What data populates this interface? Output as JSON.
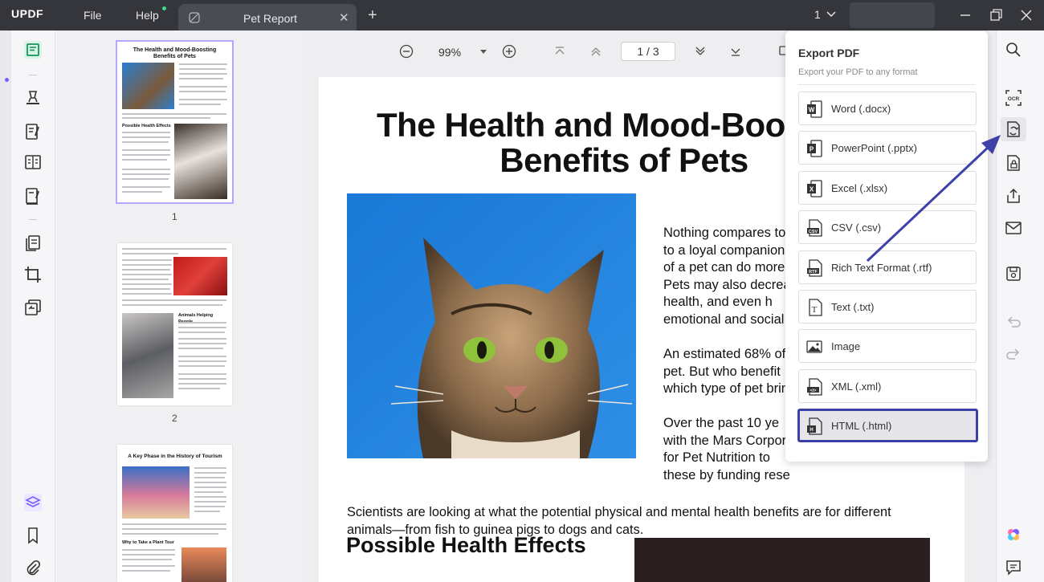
{
  "titlebar": {
    "logo": "UPDF",
    "menu": [
      "File",
      "Help"
    ],
    "tab_title": "Pet Report",
    "page_selector": "1"
  },
  "toolbar": {
    "zoom": "99%",
    "page_indicator": "1 / 3"
  },
  "thumbnails": {
    "pages": [
      {
        "number": "1",
        "title": "The Health and Mood-Boosting Benefits of Pets",
        "heading": "Possible Health Effects"
      },
      {
        "number": "2",
        "heading": "Animals Helping People"
      },
      {
        "title": "A Key Phase in the History of Tourism",
        "heading": "Why to Take a Plant Tour"
      }
    ]
  },
  "document": {
    "title_line1": "The Health and Mood-Boo",
    "title_line2": "Benefits of Pets",
    "para1": [
      "Nothing compares to",
      "to a loyal companion",
      "of a pet can do more",
      "Pets may also decrea",
      "health, and even h",
      "emotional and social"
    ],
    "para2": [
      "An estimated 68% of",
      "pet. But who benefit",
      "which type of pet brin"
    ],
    "para3": [
      "Over the past 10 ye",
      "with the Mars Corpor",
      "for Pet Nutrition to",
      "these by funding rese"
    ],
    "para4": [
      "Scientists are looking at what the potential physical and mental health benefits are for different",
      "animals—from fish to guinea pigs to dogs and cats."
    ],
    "heading2": "Possible Health Effects"
  },
  "export_panel": {
    "title": "Export PDF",
    "subtitle": "Export your PDF to any format",
    "options": [
      {
        "label": "Word (.docx)",
        "icon": "word-icon",
        "color": "#2b2b2b"
      },
      {
        "label": "PowerPoint (.pptx)",
        "icon": "powerpoint-icon",
        "color": "#2b2b2b"
      },
      {
        "label": "Excel (.xlsx)",
        "icon": "excel-icon",
        "color": "#2b2b2b"
      },
      {
        "label": "CSV (.csv)",
        "icon": "csv-icon",
        "color": "#2b2b2b"
      },
      {
        "label": "Rich Text Format (.rtf)",
        "icon": "rtf-icon",
        "color": "#2b2b2b"
      },
      {
        "label": "Text (.txt)",
        "icon": "text-icon",
        "color": "#2b2b2b"
      },
      {
        "label": "Image",
        "icon": "image-icon",
        "color": "#2b2b2b"
      },
      {
        "label": "XML (.xml)",
        "icon": "xml-icon",
        "color": "#2b2b2b"
      },
      {
        "label": "HTML (.html)",
        "icon": "html-icon",
        "color": "#2b2b2b",
        "highlighted": true
      }
    ]
  },
  "colors": {
    "titlebar_bg": "#34363c",
    "accent": "#7a5cff",
    "highlight_border": "#3b3fa8",
    "arrow": "#3d41a8"
  }
}
